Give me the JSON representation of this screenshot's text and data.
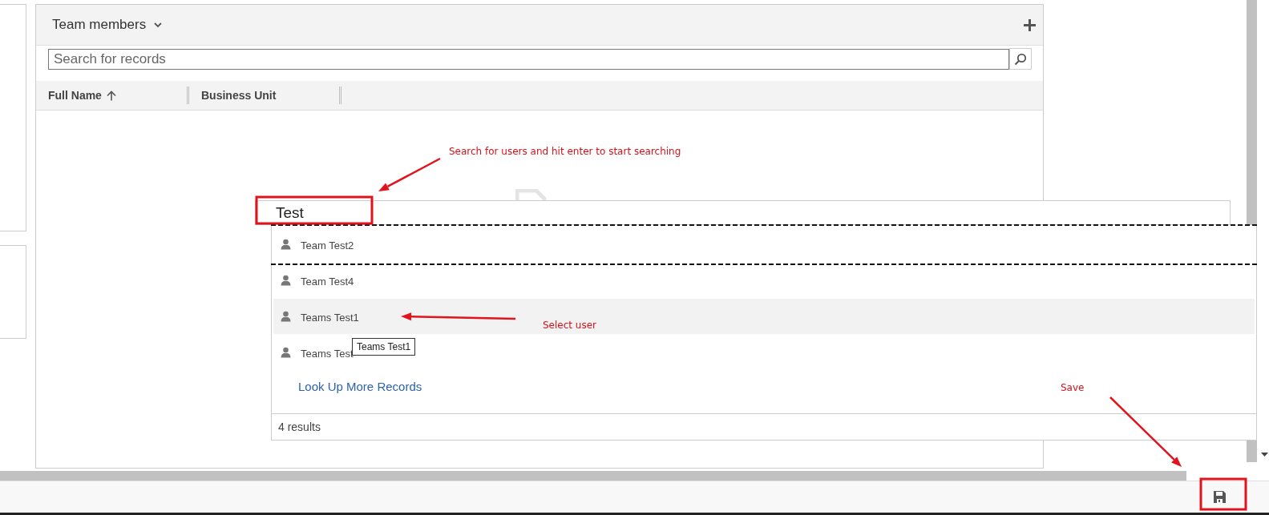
{
  "panel": {
    "title": "Team members",
    "search": {
      "placeholder": "Search for records"
    },
    "columns": [
      {
        "label": "Full Name",
        "sorted": true
      },
      {
        "label": "Business Unit",
        "sorted": false
      }
    ]
  },
  "lookup": {
    "value": "Test",
    "results": [
      {
        "name": "Team Test2",
        "selected": false
      },
      {
        "name": "Team Test4",
        "selected": false
      },
      {
        "name": "Teams Test1",
        "selected": true
      },
      {
        "name": "Teams Test",
        "selected": false
      }
    ],
    "link": "Look Up More Records",
    "count": "4 results",
    "tooltip": "Teams Test1"
  },
  "annotations": [
    "Search for users and hit enter to start searching",
    "Select user",
    "Save"
  ]
}
